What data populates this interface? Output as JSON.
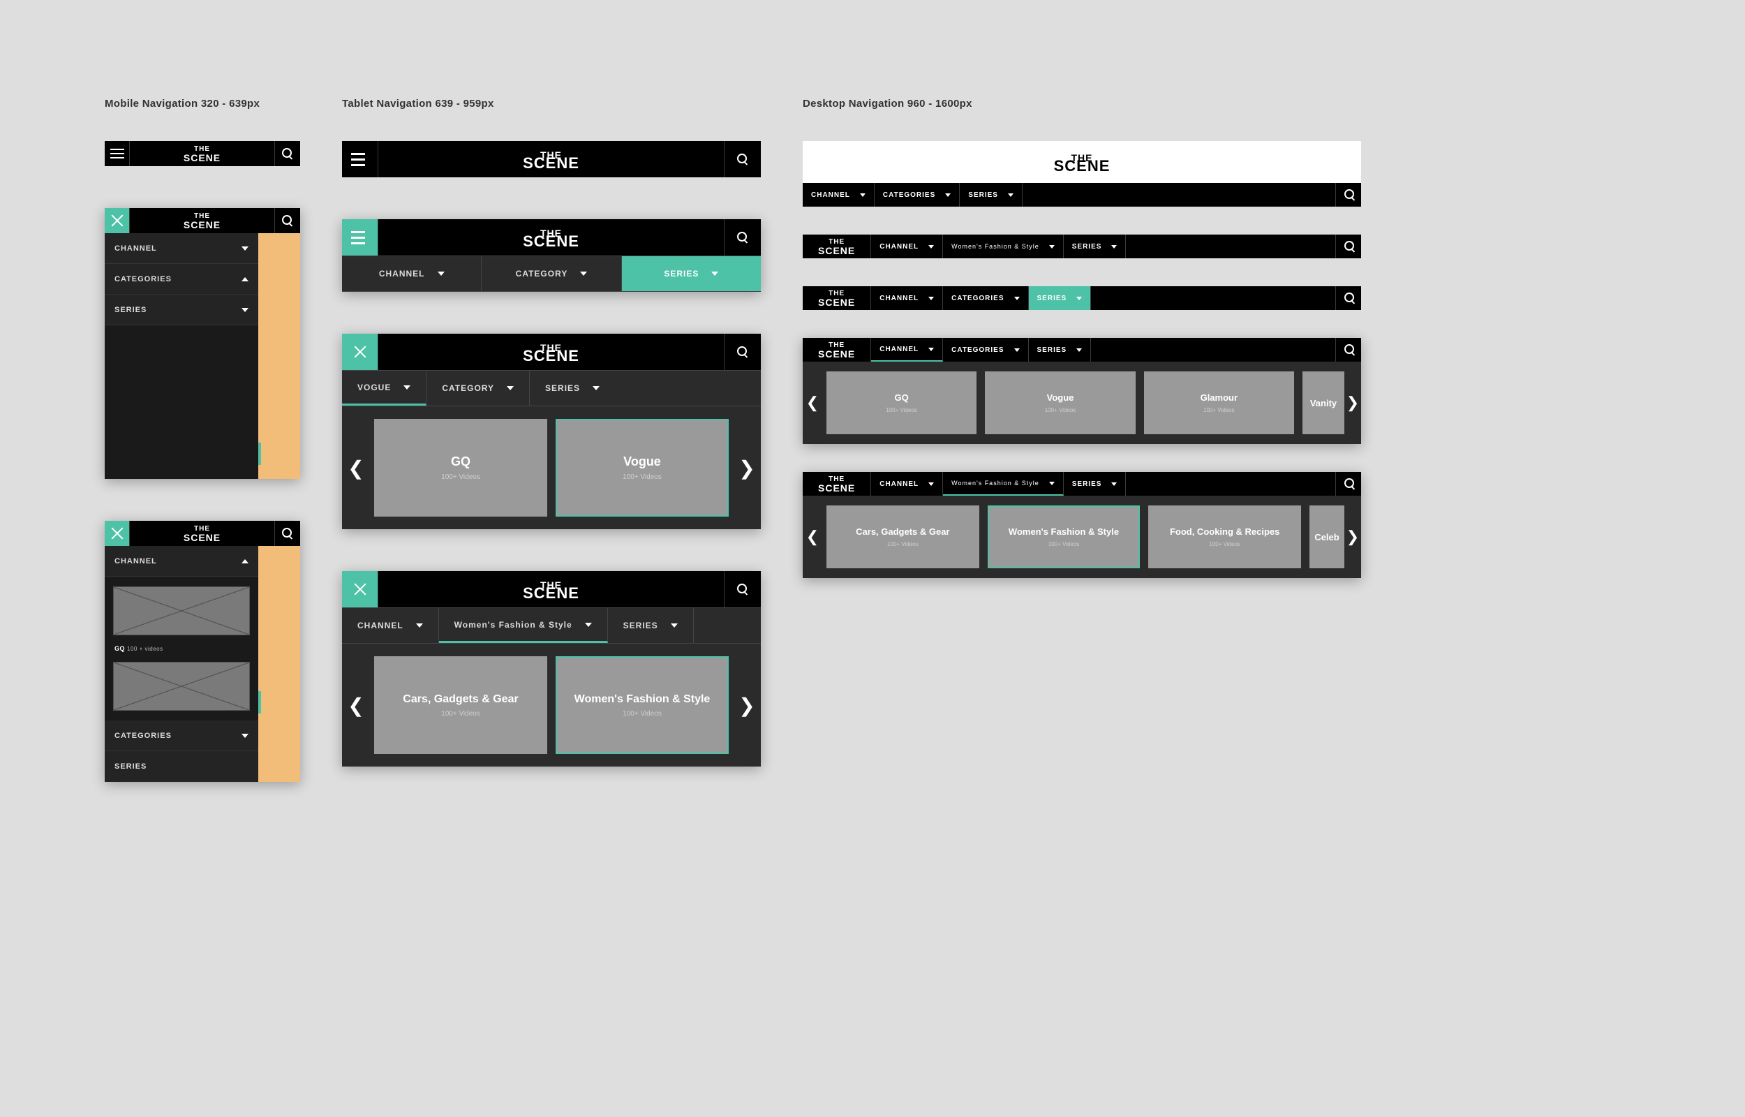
{
  "brand": {
    "top": "THE",
    "bottom": "SCENE"
  },
  "section_titles": {
    "mobile": "Mobile Navigation 320 - 639px",
    "tablet": "Tablet Navigation 639 - 959px",
    "desktop": "Desktop Navigation  960 - 1600px"
  },
  "nav": {
    "channel": "CHANNEL",
    "categories": "CATEGORIES",
    "category": "CATEGORY",
    "series": "SERIES",
    "vogue": "VOGUE",
    "womens_fashion": "Women's Fashion  & Style"
  },
  "mobile_wf": {
    "gq_label": "GQ",
    "gq_sub": "100 + videos"
  },
  "channels": [
    {
      "title": "GQ",
      "sub": "100+ Videos"
    },
    {
      "title": "Vogue",
      "sub": "100+ Videos"
    },
    {
      "title": "Glamour",
      "sub": "100+ Videos"
    },
    {
      "title": "Vanity",
      "sub": ""
    }
  ],
  "categories_cards": [
    {
      "title": "Cars, Gadgets & Gear",
      "sub": "100+ Videos"
    },
    {
      "title": "Women's Fashion & Style",
      "sub": "100+ Videos"
    },
    {
      "title": "Food, Cooking & Recipes",
      "sub": "100+ Videos"
    },
    {
      "title": "Celeb",
      "sub": ""
    }
  ]
}
